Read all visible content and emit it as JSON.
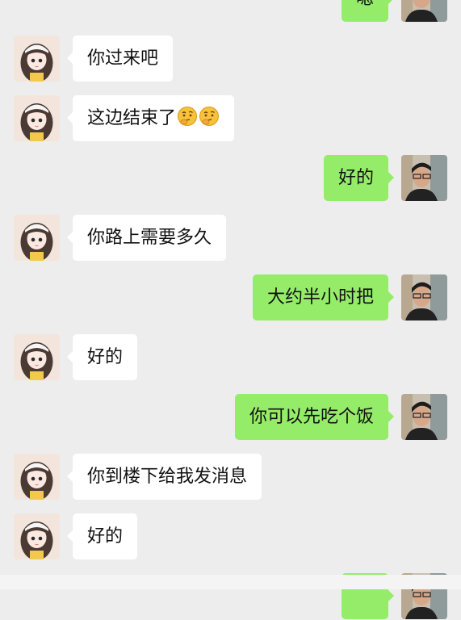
{
  "chat": {
    "messages": [
      {
        "side": "right",
        "text": "嗯"
      },
      {
        "side": "left",
        "text": "你过来吧"
      },
      {
        "side": "left",
        "text": "这边结束了",
        "emojis": [
          "thinking-emoji",
          "thinking-emoji"
        ]
      },
      {
        "side": "right",
        "text": "好的"
      },
      {
        "side": "left",
        "text": "你路上需要多久"
      },
      {
        "side": "right",
        "text": "大约半小时把"
      },
      {
        "side": "left",
        "text": "好的"
      },
      {
        "side": "right",
        "text": "你可以先吃个饭"
      },
      {
        "side": "left",
        "text": "你到楼下给我发消息"
      },
      {
        "side": "left",
        "text": "好的"
      }
    ]
  },
  "colors": {
    "background": "#ededed",
    "incoming_bubble": "#ffffff",
    "outgoing_bubble": "#95ec69",
    "text": "#111111"
  },
  "icons": {
    "contact_avatar": "girl-avatar",
    "self_avatar": "man-avatar",
    "emoji": "thinking-emoji"
  }
}
